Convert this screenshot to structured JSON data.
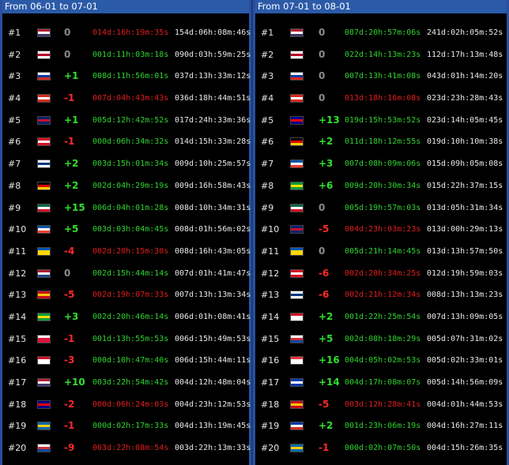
{
  "left_panel": {
    "title": "From 06-01 to 07-01",
    "rows": [
      {
        "rank": "#1",
        "flag": "us-flag",
        "flag_colors": [
          "#b22234",
          "#ffffff",
          "#3c3b6e"
        ],
        "change": "0",
        "lead": "014d:16h:19m:35s",
        "lead_sign": "neg",
        "total": "154d:06h:08m:46s"
      },
      {
        "rank": "#2",
        "flag": "jp-flag",
        "flag_colors": [
          "#ffffff",
          "#bc002d",
          "#ffffff"
        ],
        "change": "0",
        "lead": "001d:11h:03m:18s",
        "lead_sign": "pos",
        "total": "090d:03h:59m:25s"
      },
      {
        "rank": "#3",
        "flag": "ru-flag",
        "flag_colors": [
          "#ffffff",
          "#0039a6",
          "#d52b1e"
        ],
        "change": "+1",
        "lead": "008d:11h:56m:01s",
        "lead_sign": "pos",
        "total": "037d:13h:33m:12s"
      },
      {
        "rank": "#4",
        "flag": "ca-flag",
        "flag_colors": [
          "#d52b1e",
          "#ffffff",
          "#d52b1e"
        ],
        "change": "-1",
        "lead": "007d:04h:43m:43s",
        "lead_sign": "neg",
        "total": "036d:18h:44m:51s"
      },
      {
        "rank": "#5",
        "flag": "gb-flag",
        "flag_colors": [
          "#012169",
          "#c8102e",
          "#012169"
        ],
        "change": "+1",
        "lead": "005d:12h:42m:52s",
        "lead_sign": "pos",
        "total": "017d:24h:33m:36s"
      },
      {
        "rank": "#6",
        "flag": "pe-flag",
        "flag_colors": [
          "#d91023",
          "#ffffff",
          "#d91023"
        ],
        "change": "-1",
        "lead": "000d:06h:34m:32s",
        "lead_sign": "pos",
        "total": "014d:15h:33m:28s"
      },
      {
        "rank": "#7",
        "flag": "fi-flag",
        "flag_colors": [
          "#ffffff",
          "#003580",
          "#ffffff"
        ],
        "change": "+2",
        "lead": "003d:15h:01m:34s",
        "lead_sign": "pos",
        "total": "009d:10h:25m:57s"
      },
      {
        "rank": "#8",
        "flag": "de-flag",
        "flag_colors": [
          "#000000",
          "#dd0000",
          "#ffce00"
        ],
        "change": "+2",
        "lead": "002d:04h:29m:19s",
        "lead_sign": "pos",
        "total": "009d:16h:58m:43s"
      },
      {
        "rank": "#9",
        "flag": "mx-flag",
        "flag_colors": [
          "#006847",
          "#ffffff",
          "#ce1126"
        ],
        "change": "+15",
        "lead": "006d:04h:01m:28s",
        "lead_sign": "pos",
        "total": "008d:10h:34m:31s"
      },
      {
        "rank": "#10",
        "flag": "fr-flag",
        "flag_colors": [
          "#0055a4",
          "#ffffff",
          "#ef4135"
        ],
        "change": "+5",
        "lead": "003d:03h:04m:45s",
        "lead_sign": "pos",
        "total": "008d:01h:56m:02s"
      },
      {
        "rank": "#11",
        "flag": "ua-flag",
        "flag_colors": [
          "#0057b7",
          "#ffd700",
          "#ffd700"
        ],
        "change": "-4",
        "lead": "002d:20h:15m:30s",
        "lead_sign": "neg",
        "total": "008d:16h:43m:05s"
      },
      {
        "rank": "#12",
        "flag": "nl-flag",
        "flag_colors": [
          "#ae1c28",
          "#ffffff",
          "#21468b"
        ],
        "change": "0",
        "lead": "002d:15h:44m:14s",
        "lead_sign": "pos",
        "total": "007d:01h:41m:47s"
      },
      {
        "rank": "#13",
        "flag": "es-flag",
        "flag_colors": [
          "#c60b1e",
          "#ffc400",
          "#c60b1e"
        ],
        "change": "-5",
        "lead": "002d:19h:07m:33s",
        "lead_sign": "neg",
        "total": "007d:13h:13m:34s"
      },
      {
        "rank": "#14",
        "flag": "br-flag",
        "flag_colors": [
          "#009c3b",
          "#ffdf00",
          "#009c3b"
        ],
        "change": "+3",
        "lead": "002d:20h:46m:14s",
        "lead_sign": "pos",
        "total": "006d:01h:08m:41s"
      },
      {
        "rank": "#15",
        "flag": "pl-flag",
        "flag_colors": [
          "#ffffff",
          "#dc143c",
          "#dc143c"
        ],
        "change": "-1",
        "lead": "001d:13h:55m:53s",
        "lead_sign": "pos",
        "total": "006d:15h:49m:53s"
      },
      {
        "rank": "#16",
        "flag": "id-flag",
        "flag_colors": [
          "#ce1126",
          "#ffffff",
          "#ffffff"
        ],
        "change": "-3",
        "lead": "000d:10h:47m:40s",
        "lead_sign": "pos",
        "total": "006d:15h:44m:11s"
      },
      {
        "rank": "#17",
        "flag": "us-flag",
        "flag_colors": [
          "#b22234",
          "#ffffff",
          "#3c3b6e"
        ],
        "change": "+10",
        "lead": "003d:22h:54m:42s",
        "lead_sign": "pos",
        "total": "004d:12h:48m:04s"
      },
      {
        "rank": "#18",
        "flag": "au-flag",
        "flag_colors": [
          "#00008b",
          "#ff0000",
          "#00008b"
        ],
        "change": "-2",
        "lead": "000d:06h:24m:03s",
        "lead_sign": "neg",
        "total": "004d:23h:12m:53s"
      },
      {
        "rank": "#19",
        "flag": "se-flag",
        "flag_colors": [
          "#006aa7",
          "#fecc00",
          "#006aa7"
        ],
        "change": "-1",
        "lead": "000d:02h:17m:33s",
        "lead_sign": "pos",
        "total": "004d:13h:19m:45s"
      },
      {
        "rank": "#20",
        "flag": "kr-flag",
        "flag_colors": [
          "#ffffff",
          "#cd2e3a",
          "#0047a0"
        ],
        "change": "-9",
        "lead": "003d:22h:08m:54s",
        "lead_sign": "neg",
        "total": "003d:22h:13m:33s"
      }
    ]
  },
  "right_panel": {
    "title": "From 07-01 to 08-01",
    "rows": [
      {
        "rank": "#1",
        "flag": "us-flag",
        "flag_colors": [
          "#b22234",
          "#ffffff",
          "#3c3b6e"
        ],
        "change": "0",
        "lead": "087d:20h:57m:06s",
        "lead_sign": "pos",
        "total": "241d:02h:05m:52s"
      },
      {
        "rank": "#2",
        "flag": "jp-flag",
        "flag_colors": [
          "#ffffff",
          "#bc002d",
          "#ffffff"
        ],
        "change": "0",
        "lead": "022d:14h:13m:23s",
        "lead_sign": "pos",
        "total": "112d:17h:13m:48s"
      },
      {
        "rank": "#3",
        "flag": "ru-flag",
        "flag_colors": [
          "#ffffff",
          "#0039a6",
          "#d52b1e"
        ],
        "change": "0",
        "lead": "007d:13h:41m:08s",
        "lead_sign": "pos",
        "total": "043d:01h:14m:20s"
      },
      {
        "rank": "#4",
        "flag": "ca-flag",
        "flag_colors": [
          "#d52b1e",
          "#ffffff",
          "#d52b1e"
        ],
        "change": "0",
        "lead": "013d:18h:16m:08s",
        "lead_sign": "neg",
        "total": "023d:23h:28m:43s"
      },
      {
        "rank": "#5",
        "flag": "au-flag",
        "flag_colors": [
          "#00008b",
          "#ff0000",
          "#00008b"
        ],
        "change": "+13",
        "lead": "019d:15h:53m:52s",
        "lead_sign": "pos",
        "total": "023d:14h:05m:45s"
      },
      {
        "rank": "#6",
        "flag": "de-flag",
        "flag_colors": [
          "#000000",
          "#dd0000",
          "#ffce00"
        ],
        "change": "+2",
        "lead": "011d:18h:12m:55s",
        "lead_sign": "pos",
        "total": "019d:10h:10m:38s"
      },
      {
        "rank": "#7",
        "flag": "fr-flag",
        "flag_colors": [
          "#0055a4",
          "#ffffff",
          "#ef4135"
        ],
        "change": "+3",
        "lead": "007d:08h:09m:06s",
        "lead_sign": "pos",
        "total": "015d:09h:05m:08s"
      },
      {
        "rank": "#8",
        "flag": "br-flag",
        "flag_colors": [
          "#009c3b",
          "#ffdf00",
          "#009c3b"
        ],
        "change": "+6",
        "lead": "009d:20h:30m:34s",
        "lead_sign": "pos",
        "total": "015d:22h:37m:15s"
      },
      {
        "rank": "#9",
        "flag": "mx-flag",
        "flag_colors": [
          "#006847",
          "#ffffff",
          "#ce1126"
        ],
        "change": "0",
        "lead": "005d:19h:57m:03s",
        "lead_sign": "pos",
        "total": "013d:05h:31m:34s"
      },
      {
        "rank": "#10",
        "flag": "gb-flag",
        "flag_colors": [
          "#012169",
          "#c8102e",
          "#012169"
        ],
        "change": "-5",
        "lead": "004d:23h:03m:23s",
        "lead_sign": "neg",
        "total": "013d:00h:29m:13s"
      },
      {
        "rank": "#11",
        "flag": "ua-flag",
        "flag_colors": [
          "#0057b7",
          "#ffd700",
          "#ffd700"
        ],
        "change": "0",
        "lead": "005d:21h:14m:45s",
        "lead_sign": "pos",
        "total": "013d:13h:57m:50s"
      },
      {
        "rank": "#12",
        "flag": "pe-flag",
        "flag_colors": [
          "#d91023",
          "#ffffff",
          "#d91023"
        ],
        "change": "-6",
        "lead": "002d:20h:34m:25s",
        "lead_sign": "neg",
        "total": "012d:19h:59m:03s"
      },
      {
        "rank": "#13",
        "flag": "fi-flag",
        "flag_colors": [
          "#ffffff",
          "#003580",
          "#ffffff"
        ],
        "change": "-6",
        "lead": "002d:21h:12m:34s",
        "lead_sign": "neg",
        "total": "008d:13h:13m:23s"
      },
      {
        "rank": "#14",
        "flag": "id-flag",
        "flag_colors": [
          "#ce1126",
          "#ffffff",
          "#ffffff"
        ],
        "change": "+2",
        "lead": "001d:22h:25m:54s",
        "lead_sign": "pos",
        "total": "007d:13h:09m:05s"
      },
      {
        "rank": "#15",
        "flag": "kr-flag",
        "flag_colors": [
          "#ffffff",
          "#cd2e3a",
          "#0047a0"
        ],
        "change": "+5",
        "lead": "002d:08h:18m:29s",
        "lead_sign": "pos",
        "total": "005d:07h:31m:02s"
      },
      {
        "rank": "#16",
        "flag": "sg-flag",
        "flag_colors": [
          "#ef3340",
          "#ffffff",
          "#ffffff"
        ],
        "change": "+16",
        "lead": "004d:05h:02m:53s",
        "lead_sign": "pos",
        "total": "005d:02h:33m:01s"
      },
      {
        "rank": "#17",
        "flag": "uy-flag",
        "flag_colors": [
          "#0038a8",
          "#ffffff",
          "#0038a8"
        ],
        "change": "+14",
        "lead": "004d:17h:08m:07s",
        "lead_sign": "pos",
        "total": "005d:14h:56m:09s"
      },
      {
        "rank": "#18",
        "flag": "es-flag",
        "flag_colors": [
          "#c60b1e",
          "#ffc400",
          "#c60b1e"
        ],
        "change": "-5",
        "lead": "003d:12h:28m:41s",
        "lead_sign": "neg",
        "total": "004d:01h:44m:53s"
      },
      {
        "rank": "#19",
        "flag": "cl-flag",
        "flag_colors": [
          "#0039a6",
          "#ffffff",
          "#d52b1e"
        ],
        "change": "+2",
        "lead": "001d:23h:06m:19s",
        "lead_sign": "pos",
        "total": "004d:16h:27m:11s"
      },
      {
        "rank": "#20",
        "flag": "se-flag",
        "flag_colors": [
          "#006aa7",
          "#fecc00",
          "#006aa7"
        ],
        "change": "-1",
        "lead": "000d:02h:07m:50s",
        "lead_sign": "pos",
        "total": "004d:15h:26m:35s"
      }
    ]
  }
}
